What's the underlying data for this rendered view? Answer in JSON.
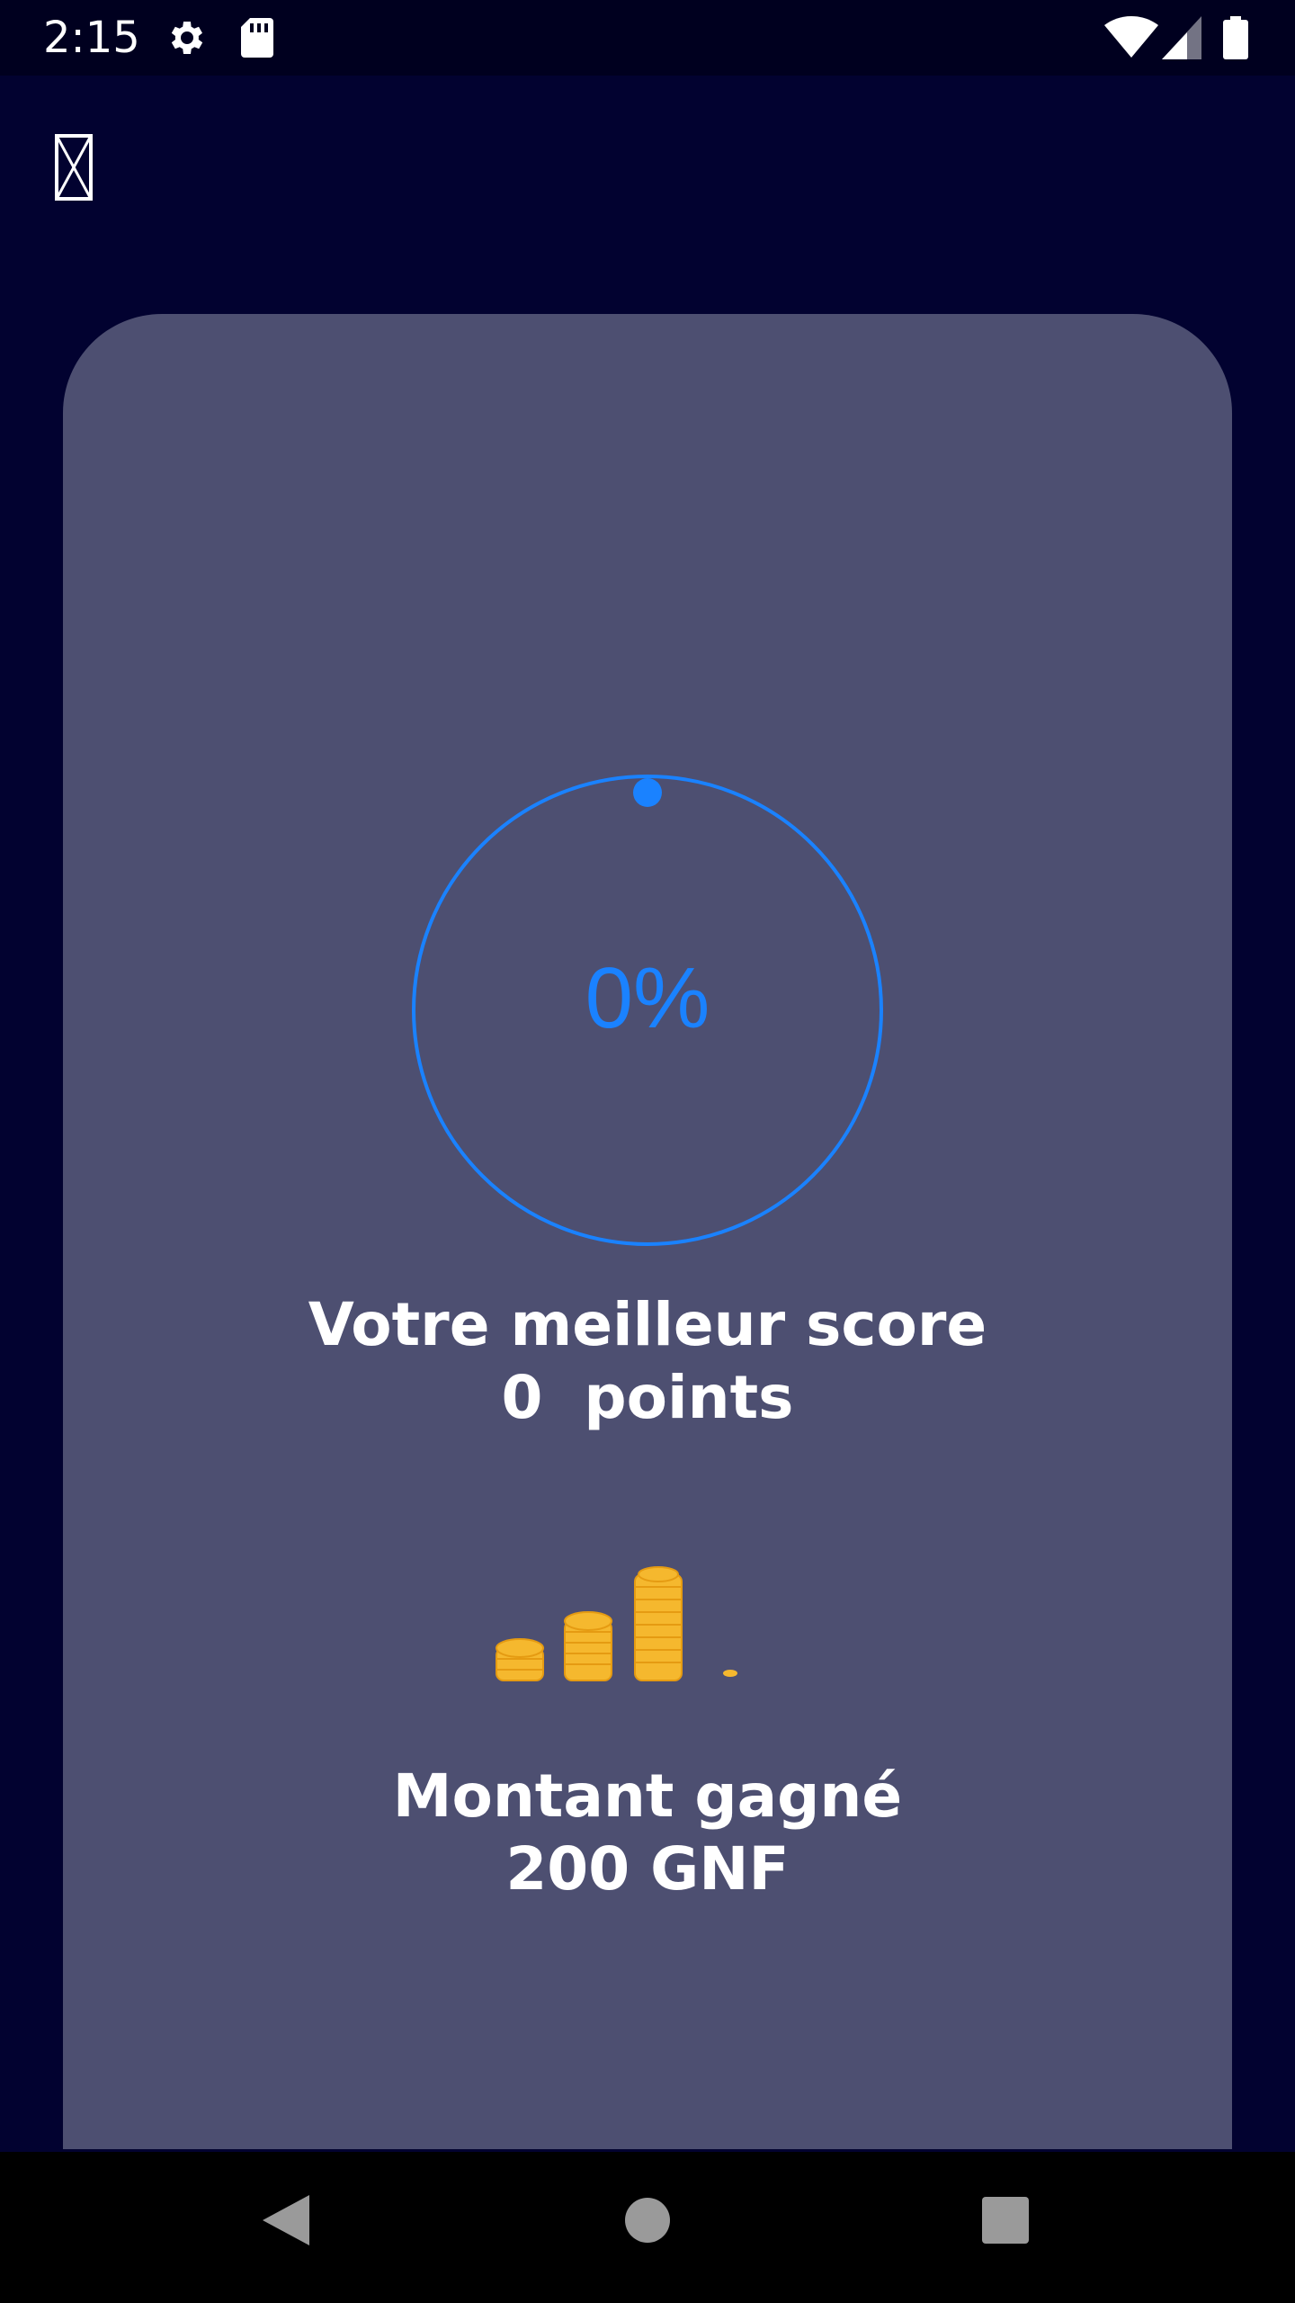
{
  "status_bar": {
    "time": "2:15",
    "icons": [
      "settings-icon",
      "sd-card-icon",
      "wifi-icon",
      "cell-signal-icon",
      "battery-icon"
    ]
  },
  "top_bar": {
    "close_icon": "broken-image-icon"
  },
  "progress": {
    "value": 0,
    "label": "0%",
    "color": "#1a82ff"
  },
  "score": {
    "title": "Votre meilleur score",
    "value": "0  points"
  },
  "amount": {
    "icon": "coin-stacks-icon",
    "title": "Montant gagné",
    "value": "200 GNF"
  },
  "colors": {
    "background": "#020230",
    "card": "#4d4f71",
    "accent": "#1a82ff",
    "coin": "#f5b82e"
  },
  "nav_bar": {
    "buttons": [
      "back-icon",
      "home-icon",
      "recents-icon"
    ]
  }
}
